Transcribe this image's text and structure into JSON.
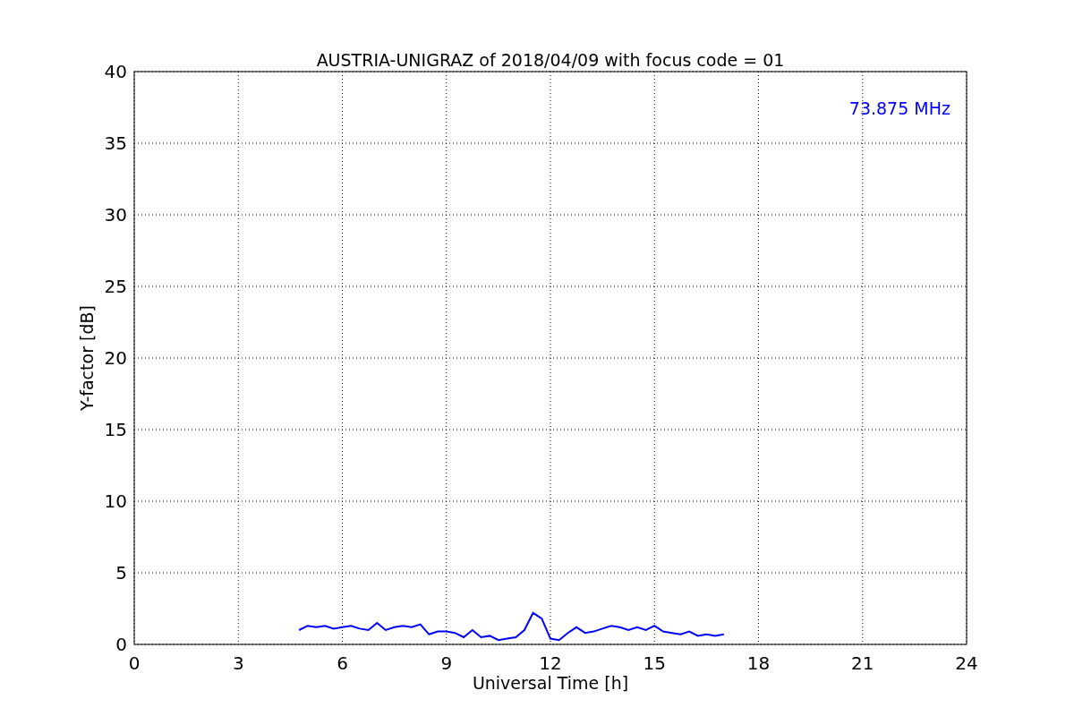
{
  "chart_data": {
    "type": "line",
    "title": "AUSTRIA-UNIGRAZ of 2018/04/09 with focus code = 01",
    "xlabel": "Universal Time [h]",
    "ylabel": "Y-factor [dB]",
    "x": [
      4.75,
      5,
      5.25,
      5.5,
      5.75,
      6,
      6.25,
      6.5,
      6.75,
      7,
      7.25,
      7.5,
      7.75,
      8,
      8.25,
      8.5,
      8.75,
      9,
      9.25,
      9.5,
      9.75,
      10,
      10.25,
      10.5,
      10.75,
      11,
      11.25,
      11.5,
      11.75,
      12,
      12.25,
      12.5,
      12.75,
      13,
      13.25,
      13.5,
      13.75,
      14,
      14.25,
      14.5,
      14.75,
      15,
      15.25,
      15.5,
      15.75,
      16,
      16.25,
      16.5,
      16.75,
      17
    ],
    "series": [
      {
        "name": "73.875 MHz",
        "color": "#0000ff",
        "values": [
          1.0,
          1.3,
          1.2,
          1.3,
          1.1,
          1.2,
          1.3,
          1.1,
          1.0,
          1.5,
          1.0,
          1.2,
          1.3,
          1.2,
          1.4,
          0.7,
          0.9,
          0.9,
          0.8,
          0.5,
          1.0,
          0.5,
          0.6,
          0.3,
          0.4,
          0.5,
          1.0,
          2.2,
          1.8,
          0.4,
          0.3,
          0.8,
          1.2,
          0.8,
          0.9,
          1.1,
          1.3,
          1.2,
          1.0,
          1.2,
          1.0,
          1.3,
          0.9,
          0.8,
          0.7,
          0.9,
          0.6,
          0.7,
          0.6,
          0.7
        ]
      }
    ],
    "xlim": [
      0,
      24
    ],
    "ylim": [
      0,
      40
    ],
    "xticks": [
      0,
      3,
      6,
      9,
      12,
      15,
      18,
      21,
      24
    ],
    "yticks": [
      0,
      5,
      10,
      15,
      20,
      25,
      30,
      35,
      40
    ],
    "grid": true
  }
}
